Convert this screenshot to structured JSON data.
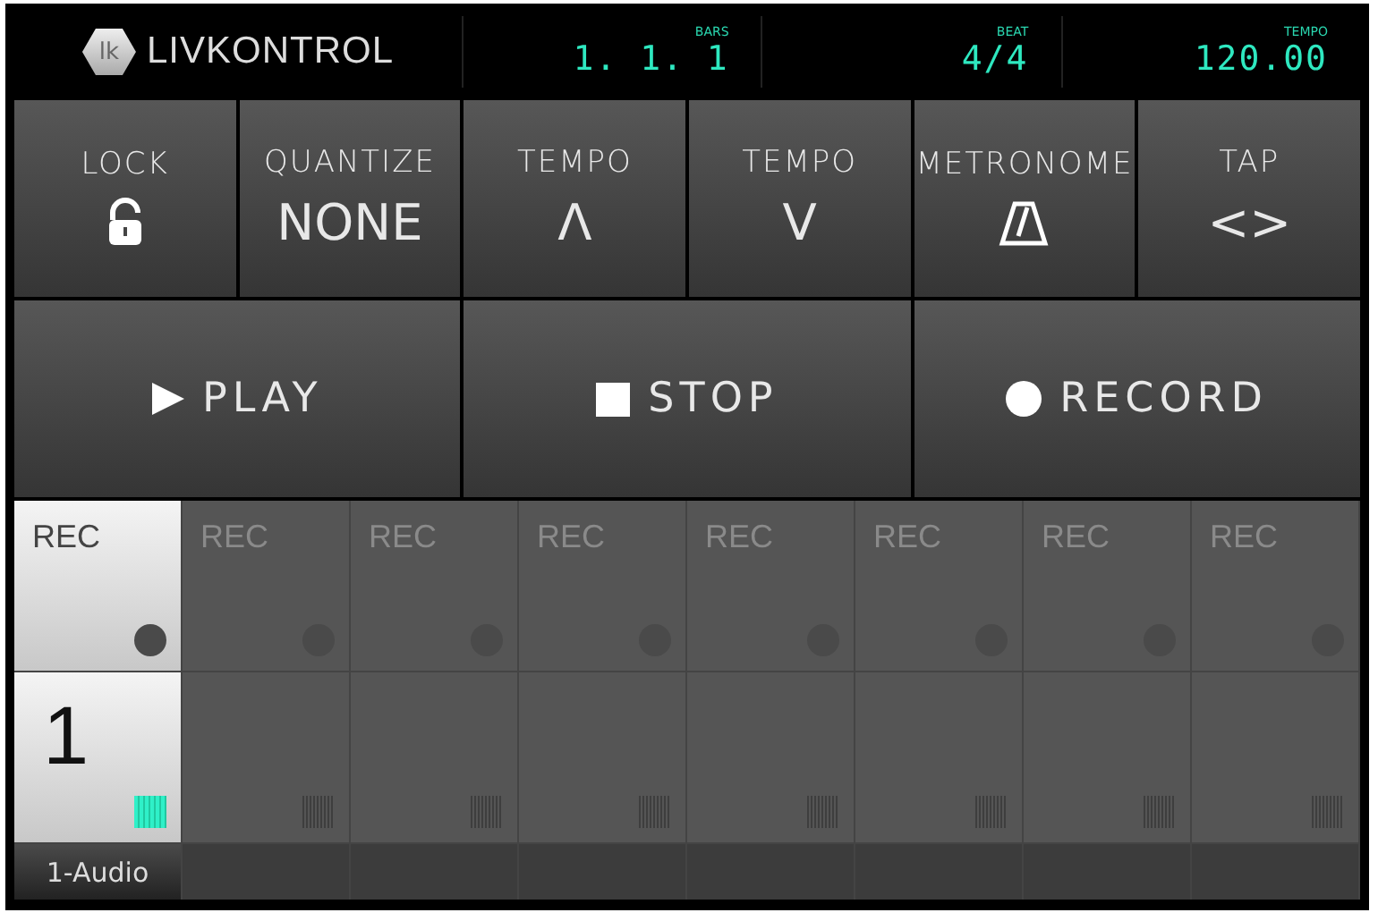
{
  "header": {
    "logo_text": "LIVKONTROL",
    "logo_mark": "lk",
    "readouts": [
      {
        "label": "BARS",
        "value": "1. 1. 1"
      },
      {
        "label": "BEAT",
        "value": "4/4"
      },
      {
        "label": "TEMPO",
        "value": "120.00"
      }
    ]
  },
  "controls": [
    {
      "label": "LOCK",
      "kind": "lock"
    },
    {
      "label": "QUANTIZE",
      "kind": "text",
      "value": "NONE"
    },
    {
      "label": "TEMPO",
      "kind": "text",
      "value": "Λ"
    },
    {
      "label": "TEMPO",
      "kind": "text",
      "value": "V"
    },
    {
      "label": "METRONOME",
      "kind": "metronome"
    },
    {
      "label": "TAP",
      "kind": "text",
      "value": "<>"
    }
  ],
  "transport": [
    {
      "label": "PLAY",
      "kind": "play"
    },
    {
      "label": "STOP",
      "kind": "stop"
    },
    {
      "label": "RECORD",
      "kind": "record"
    }
  ],
  "tracks": [
    {
      "rec_label": "REC",
      "active": true,
      "clip_label": "1",
      "name": "1-Audio"
    },
    {
      "rec_label": "REC",
      "active": false
    },
    {
      "rec_label": "REC",
      "active": false
    },
    {
      "rec_label": "REC",
      "active": false
    },
    {
      "rec_label": "REC",
      "active": false
    },
    {
      "rec_label": "REC",
      "active": false
    },
    {
      "rec_label": "REC",
      "active": false
    },
    {
      "rec_label": "REC",
      "active": false
    }
  ]
}
